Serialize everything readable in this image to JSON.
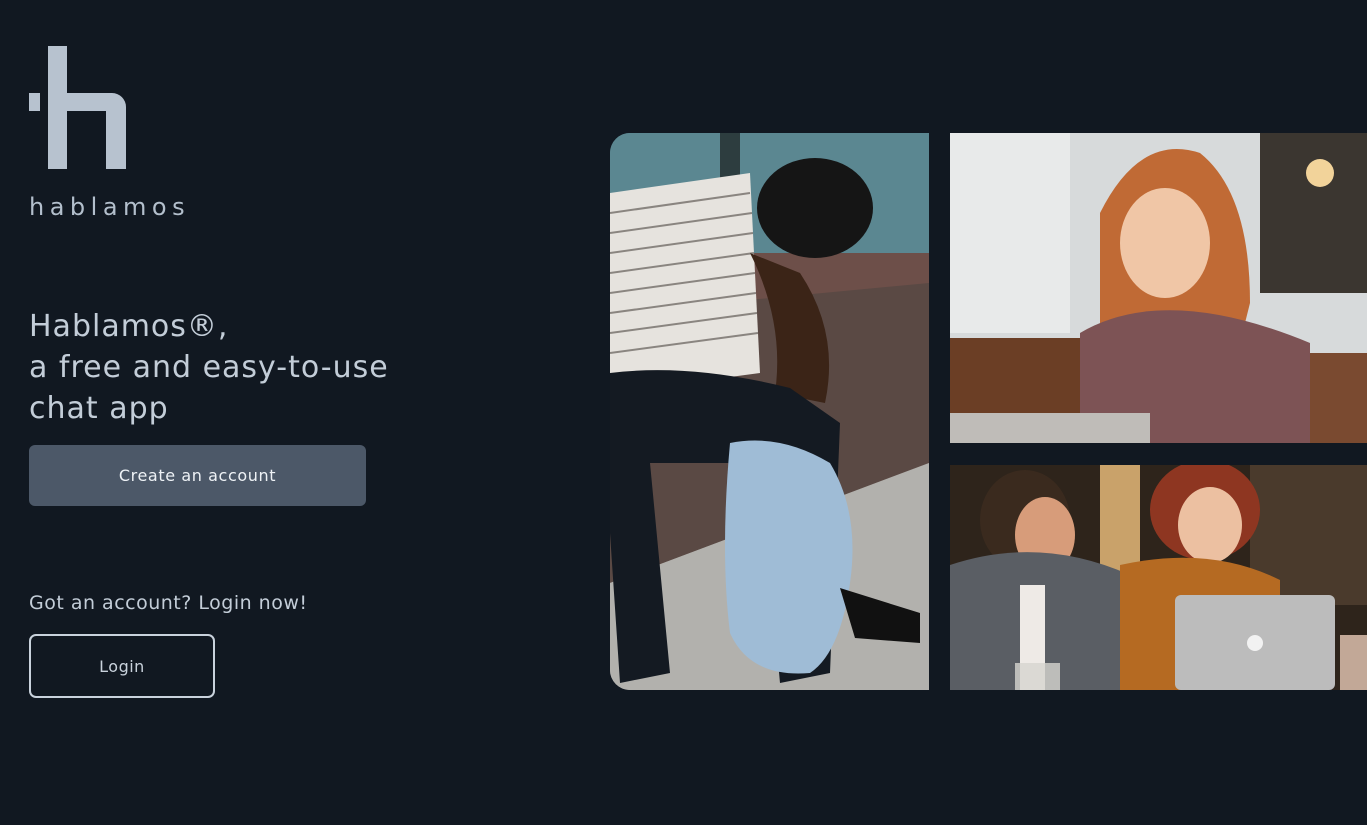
{
  "brand": {
    "name": "hablamos"
  },
  "hero": {
    "line1": "Hablamos®,",
    "line2": "a free and easy-to-use",
    "line3": "chat app"
  },
  "actions": {
    "create_account_label": "Create an account",
    "login_prompt": "Got an account? Login now!",
    "login_label": "Login"
  },
  "colors": {
    "background": "#111821",
    "primary_button": "#4c5868",
    "text": "#c3cdd8"
  }
}
